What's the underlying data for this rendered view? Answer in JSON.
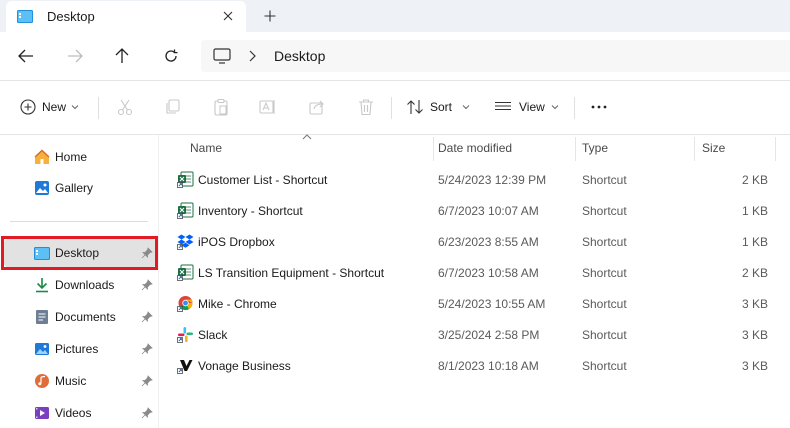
{
  "window": {
    "tab_title": "Desktop"
  },
  "address": {
    "location": "Desktop"
  },
  "toolbar": {
    "new_label": "New",
    "sort_label": "Sort",
    "view_label": "View"
  },
  "sidebar": {
    "items": [
      {
        "label": "Home",
        "icon": "home-icon"
      },
      {
        "label": "Gallery",
        "icon": "gallery-icon"
      },
      {
        "label": "Desktop",
        "icon": "desktop-icon"
      },
      {
        "label": "Downloads",
        "icon": "downloads-icon"
      },
      {
        "label": "Documents",
        "icon": "documents-icon"
      },
      {
        "label": "Pictures",
        "icon": "pictures-icon"
      },
      {
        "label": "Music",
        "icon": "music-icon"
      },
      {
        "label": "Videos",
        "icon": "videos-icon"
      }
    ],
    "selected": "Desktop"
  },
  "files": {
    "columns": [
      "Name",
      "Date modified",
      "Type",
      "Size"
    ],
    "rows": [
      {
        "name": "Customer List - Shortcut",
        "date": "5/24/2023 12:39 PM",
        "type": "Shortcut",
        "size": "2 KB",
        "icon": "excel-icon"
      },
      {
        "name": "Inventory - Shortcut",
        "date": "6/7/2023 10:07 AM",
        "type": "Shortcut",
        "size": "1 KB",
        "icon": "excel-icon"
      },
      {
        "name": "iPOS Dropbox",
        "date": "6/23/2023 8:55 AM",
        "type": "Shortcut",
        "size": "1 KB",
        "icon": "dropbox-icon"
      },
      {
        "name": "LS Transition Equipment - Shortcut",
        "date": "6/7/2023 10:58 AM",
        "type": "Shortcut",
        "size": "2 KB",
        "icon": "excel-icon"
      },
      {
        "name": "Mike - Chrome",
        "date": "5/24/2023 10:55 AM",
        "type": "Shortcut",
        "size": "3 KB",
        "icon": "chrome-icon"
      },
      {
        "name": "Slack",
        "date": "3/25/2024 2:58 PM",
        "type": "Shortcut",
        "size": "3 KB",
        "icon": "slack-icon"
      },
      {
        "name": "Vonage Business",
        "date": "8/1/2023 10:18 AM",
        "type": "Shortcut",
        "size": "3 KB",
        "icon": "vonage-icon"
      }
    ]
  },
  "colors": {
    "highlight": "#e01b24",
    "selected_bg": "#e2e2e2",
    "accent": "#0067c0"
  }
}
